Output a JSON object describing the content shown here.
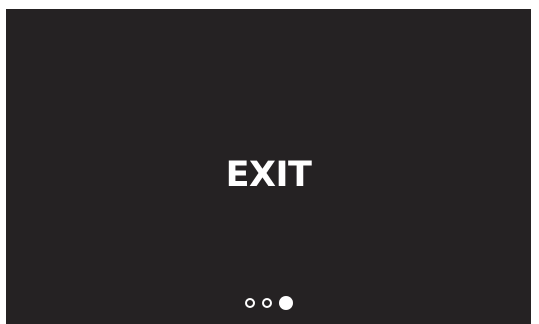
{
  "screen": {
    "label": "EXIT",
    "background_color": "#252223",
    "text_color": "#ffffff"
  },
  "pagination": {
    "total": 3,
    "current": 3
  }
}
